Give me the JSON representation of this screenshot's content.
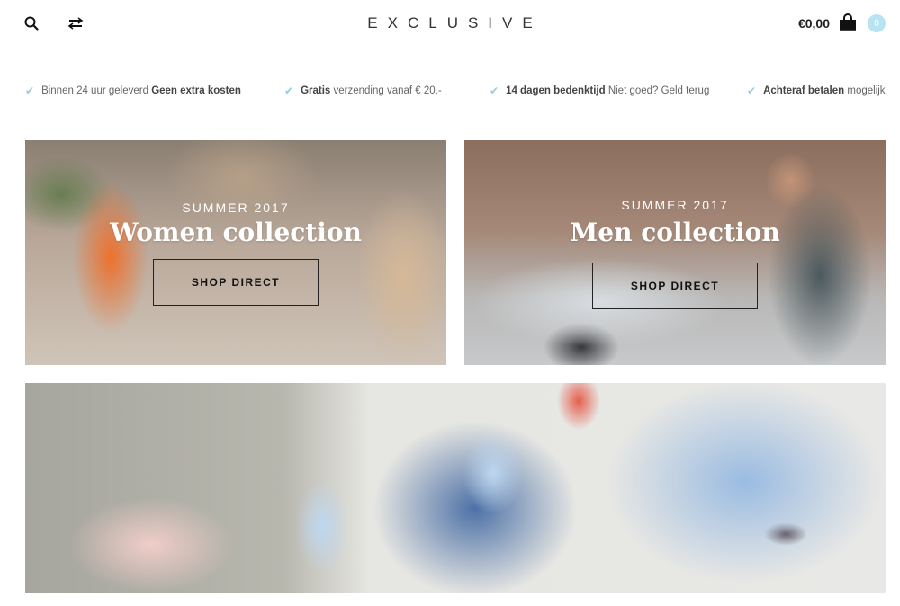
{
  "header": {
    "logo": "EXCLUSIVE",
    "cart_total": "€0,00",
    "cart_count": "0",
    "icons": {
      "search": "search-icon",
      "compare": "compare-arrows-icon",
      "cart": "shopping-bag-icon"
    }
  },
  "usps": [
    {
      "pre": "Binnen 24 uur geleverd ",
      "bold": "Geen extra kosten",
      "post": ""
    },
    {
      "pre": "",
      "bold": "Gratis",
      "post": " verzending vanaf € 20,-"
    },
    {
      "pre": "",
      "bold": "14 dagen bedenktijd",
      "post": " Niet goed? Geld terug"
    },
    {
      "pre": "",
      "bold": "Achteraf betalen",
      "post": " mogelijk"
    }
  ],
  "banners": {
    "women": {
      "subtitle": "SUMMER 2017",
      "title": "Women collection",
      "button": "SHOP DIRECT"
    },
    "men": {
      "subtitle": "SUMMER 2017",
      "title": "Men collection",
      "button": "SHOP DIRECT"
    }
  },
  "colors": {
    "accent": "#8fd0e6",
    "badge": "#b8e3f2"
  }
}
